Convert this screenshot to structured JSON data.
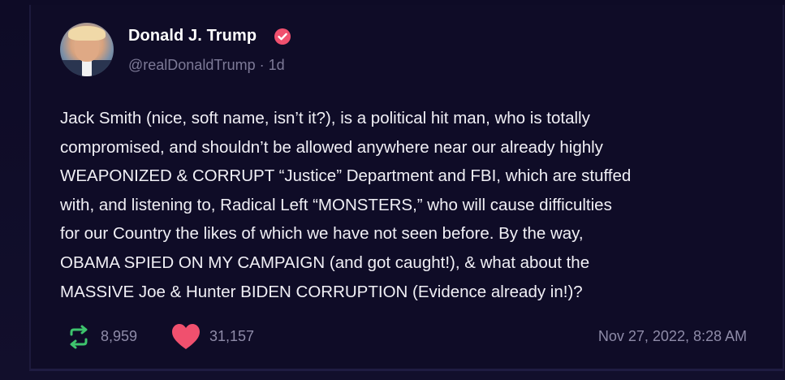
{
  "post": {
    "author_name": "Donald J. Trump",
    "handle_line": "@realDonaldTrump · 1d",
    "avatar_icon": "profile-photo",
    "verified_icon": "verified-badge-icon",
    "verified_color": "#f0506e",
    "text_lines": [
      "Jack Smith (nice, soft name, isn’t it?), is a political hit man, who is totally",
      "compromised, and shouldn’t be allowed anywhere near our already highly",
      "WEAPONIZED & CORRUPT “Justice” Department and FBI, which are stuffed",
      "with, and listening to, Radical Left “MONSTERS,” who will  cause difficulties",
      "for our Country the likes of which we have not seen before. By the way,",
      "OBAMA SPIED ON MY CAMPAIGN (and got caught!), & what about the",
      "MASSIVE Joe & Hunter BIDEN CORRUPTION (Evidence already in!)?"
    ],
    "repost_count": "8,959",
    "like_count": "31,157",
    "timestamp": "Nov 27, 2022, 8:28 AM",
    "repost_icon": "repost-icon",
    "repost_color": "#3ec46d",
    "like_icon": "heart-icon",
    "like_color": "#f0506e"
  }
}
